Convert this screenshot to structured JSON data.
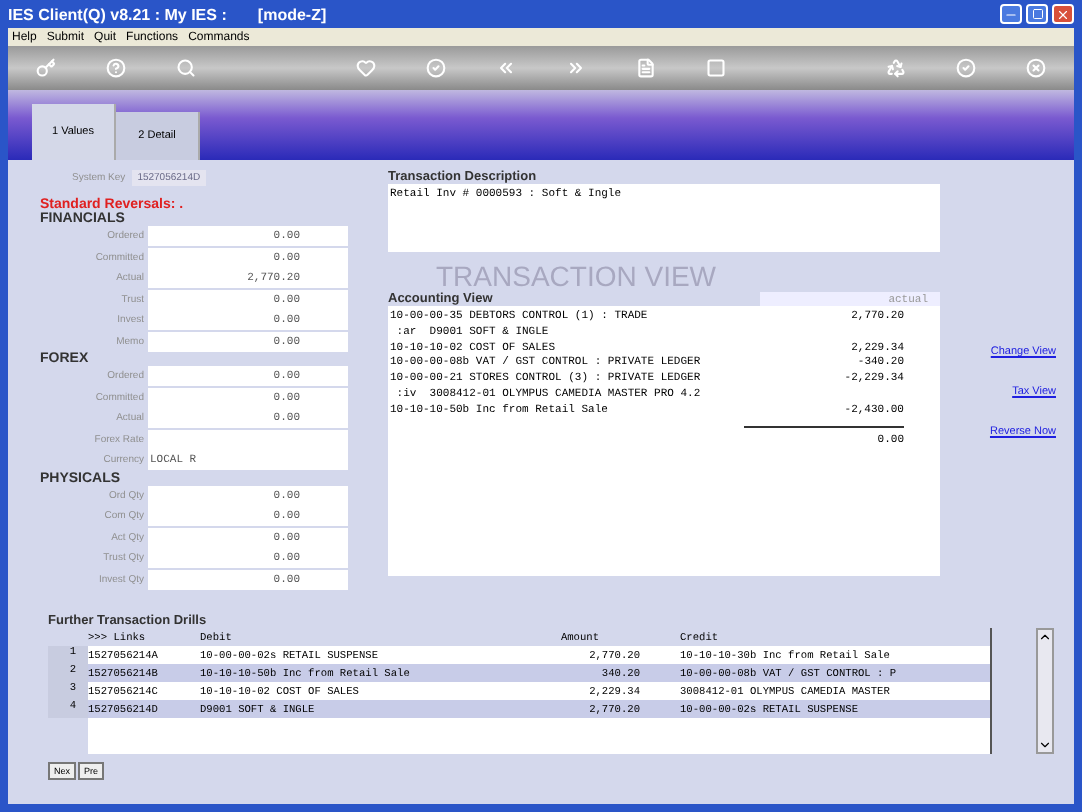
{
  "window": {
    "title": "IES Client(Q) v8.21 : My IES :       [mode-Z]"
  },
  "menu": [
    "Help",
    "Submit",
    "Quit",
    "Functions",
    "Commands"
  ],
  "tabs": [
    {
      "label": "1 Values",
      "selected": true
    },
    {
      "label": "2 Detail",
      "selected": false
    }
  ],
  "system_key": {
    "label": "System Key",
    "value": "1527056214D"
  },
  "section_title": "Standard Reversals: .",
  "groups": [
    {
      "title": "FINANCIALS",
      "fields": [
        {
          "label": "Ordered",
          "value": "0.00"
        },
        {
          "label": "Committed",
          "value": "0.00"
        },
        {
          "label": "Actual",
          "value": "2,770.20"
        },
        {
          "label": "Trust",
          "value": "0.00"
        },
        {
          "label": "Invest",
          "value": "0.00"
        },
        {
          "label": "Memo",
          "value": "0.00"
        }
      ]
    },
    {
      "title": "FOREX",
      "fields": [
        {
          "label": "Ordered",
          "value": "0.00"
        },
        {
          "label": "Committed",
          "value": "0.00"
        },
        {
          "label": "Actual",
          "value": "0.00"
        },
        {
          "label": "Forex Rate"
        },
        {
          "label": "Currency",
          "value": "LOCAL R",
          "kind": "text"
        }
      ]
    },
    {
      "title": "PHYSICALS",
      "fields": [
        {
          "label": "Ord Qty",
          "value": "0.00"
        },
        {
          "label": "Com Qty",
          "value": "0.00"
        },
        {
          "label": "Act Qty",
          "value": "0.00"
        },
        {
          "label": "Trust Qty",
          "value": "0.00"
        },
        {
          "label": "Invest Qty",
          "value": "0.00"
        }
      ]
    }
  ],
  "transaction_description": {
    "label": "Transaction Description",
    "value": "Retail Inv # 0000593 : Soft & Ingle"
  },
  "view_heading": "TRANSACTION VIEW",
  "accounting_view": {
    "label": "Accounting View",
    "mode": "actual",
    "lines": [
      {
        "account": "10-00-00-35 DEBTORS CONTROL (1) : TRADE",
        "amount": "2,770.20"
      },
      {
        "account": " :ar  D9001 SOFT & INGLE"
      },
      {
        "account": "10-10-10-02 COST OF SALES",
        "amount": "2,229.34"
      },
      {
        "account": "10-00-00-08b VAT / GST CONTROL : PRIVATE LEDGER",
        "amount": "-340.20"
      },
      {
        "account": "10-00-00-21 STORES CONTROL (3) : PRIVATE LEDGER",
        "amount": "-2,229.34"
      },
      {
        "account": " :iv  3008412-01 OLYMPUS CAMEDIA MASTER PRO 4.2"
      },
      {
        "account": "10-10-10-50b Inc from Retail Sale",
        "amount": "-2,430.00"
      }
    ],
    "total": "0.00"
  },
  "links": [
    "Change View",
    "Tax View",
    "Reverse Now"
  ],
  "drills": {
    "title": "Further Transaction Drills",
    "columns": [
      ">>> Links",
      "Debit",
      "Amount",
      "Credit"
    ],
    "rows": [
      {
        "index": "1",
        "link": "1527056214A",
        "debit": "10-00-00-02s RETAIL SUSPENSE",
        "amount": "2,770.20",
        "credit": "10-10-10-30b Inc from Retail Sale"
      },
      {
        "index": "2",
        "link": "1527056214B",
        "debit": "10-10-10-50b Inc from Retail Sale",
        "amount": "340.20",
        "credit": "10-00-00-08b VAT / GST CONTROL : P"
      },
      {
        "index": "3",
        "link": "1527056214C",
        "debit": "10-10-10-02 COST OF SALES",
        "amount": "2,229.34",
        "credit": "3008412-01 OLYMPUS CAMEDIA MASTER"
      },
      {
        "index": "4",
        "link": "1527056214D",
        "debit": "D9001 SOFT & INGLE",
        "amount": "2,770.20",
        "credit": "10-00-00-02s RETAIL SUSPENSE"
      }
    ]
  },
  "nav_buttons": [
    "Nex",
    "Pre"
  ]
}
